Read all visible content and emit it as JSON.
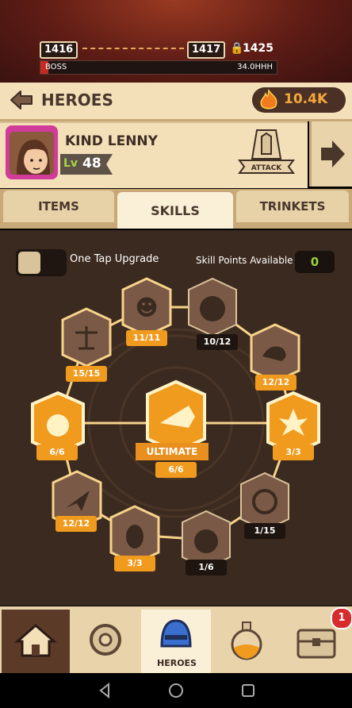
{
  "boss_bar": {
    "current_level": "1416",
    "next_level": "1417",
    "locked_level": "1425",
    "label": "BOSS",
    "hp": "34.0HHH"
  },
  "header": {
    "title": "HEROES",
    "currency_value": "10.4K"
  },
  "hero": {
    "name": "KIND LENNY",
    "level_prefix": "Lv",
    "level": "48",
    "role": "ATTACK"
  },
  "tabs": [
    {
      "label": "ITEMS",
      "active": false
    },
    {
      "label": "SKILLS",
      "active": true
    },
    {
      "label": "TRINKETS",
      "active": false
    }
  ],
  "skills_panel": {
    "one_tap_label": "One Tap Upgrade",
    "skill_points_label": "Skill Points Available",
    "skill_points_value": "0",
    "ultimate_label": "ULTIMATE",
    "ultimate_count": "6/6",
    "skills": [
      {
        "icon": "gorilla-icon",
        "count": "11/11",
        "maxed": true
      },
      {
        "icon": "pumpkin-icon",
        "count": "10/12",
        "maxed": false
      },
      {
        "icon": "island-icon",
        "count": "12/12",
        "maxed": true
      },
      {
        "icon": "explosion-icon",
        "count": "3/3",
        "maxed": true
      },
      {
        "icon": "target-heart-icon",
        "count": "1/15",
        "maxed": false
      },
      {
        "icon": "monkey-face-icon",
        "count": "1/6",
        "maxed": false
      },
      {
        "icon": "egg-icon",
        "count": "3/3",
        "maxed": true
      },
      {
        "icon": "paper-plane-icon",
        "count": "12/12",
        "maxed": true
      },
      {
        "icon": "apple-icon",
        "count": "6/6",
        "maxed": true
      },
      {
        "icon": "scales-icon",
        "count": "15/15",
        "maxed": true
      }
    ]
  },
  "bottom_nav": {
    "active_label": "HEROES",
    "notification_count": "1"
  },
  "colors": {
    "accent_orange": "#f09a1e",
    "panel_beige": "#f3dfb8",
    "board_brown": "#3b2a1f",
    "level_green": "#96d23a"
  }
}
